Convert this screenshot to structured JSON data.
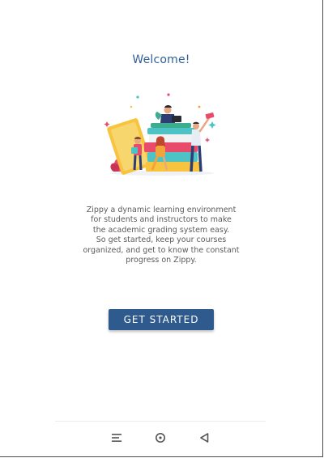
{
  "welcome": {
    "title": "Welcome!",
    "description_lines": [
      "Zippy a dynamic learning environment",
      "for students and instructors to make",
      "the academic grading system easy.",
      "So get started, keep your courses",
      "organized, and get to know the constant",
      "progress on Zippy."
    ],
    "cta_label": "GET STARTED"
  },
  "navbar": {
    "recents_icon": "menu-lines-icon",
    "home_icon": "circle-home-icon",
    "back_icon": "triangle-back-icon"
  },
  "colors": {
    "primary": "#2e5a8e",
    "title": "#2f5f96",
    "text": "#5b5b5b"
  }
}
